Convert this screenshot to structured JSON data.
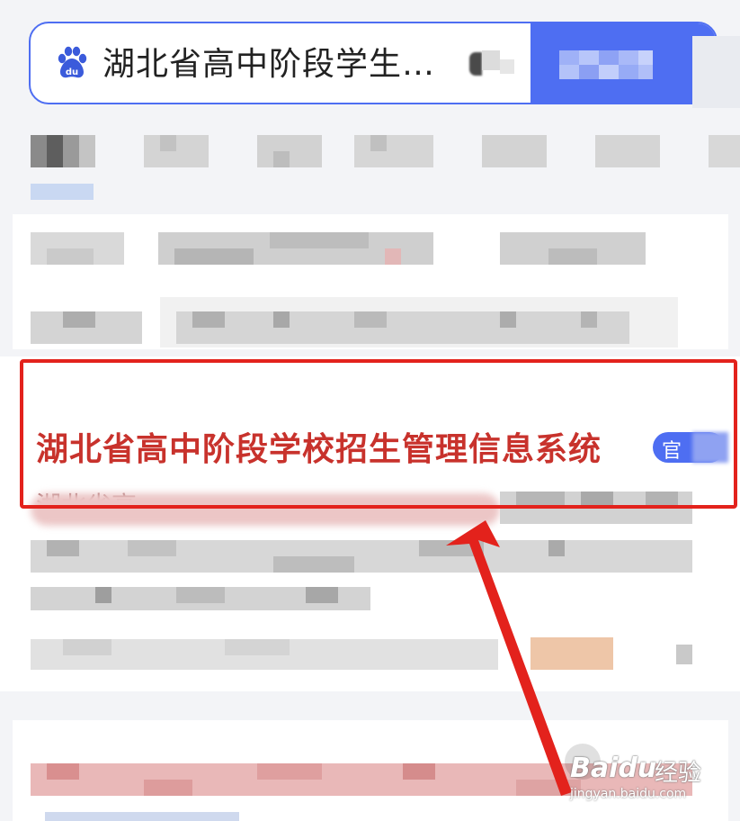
{
  "search": {
    "query": "湖北省高中阶段学生…"
  },
  "result": {
    "title": "湖北省高中阶段学校招生管理信息系统",
    "badge": "官",
    "snippet_start": "湖北省高"
  },
  "watermark": {
    "brand": "Baidu",
    "product": "经验",
    "url": "jingyan.baidu.com"
  },
  "colors": {
    "accent": "#4e6ef2",
    "title_red": "#c8322c",
    "annotation_red": "#e3221c"
  },
  "icons": {
    "search_logo": "baidu-paw-icon",
    "annotation": "red-arrow-icon"
  }
}
